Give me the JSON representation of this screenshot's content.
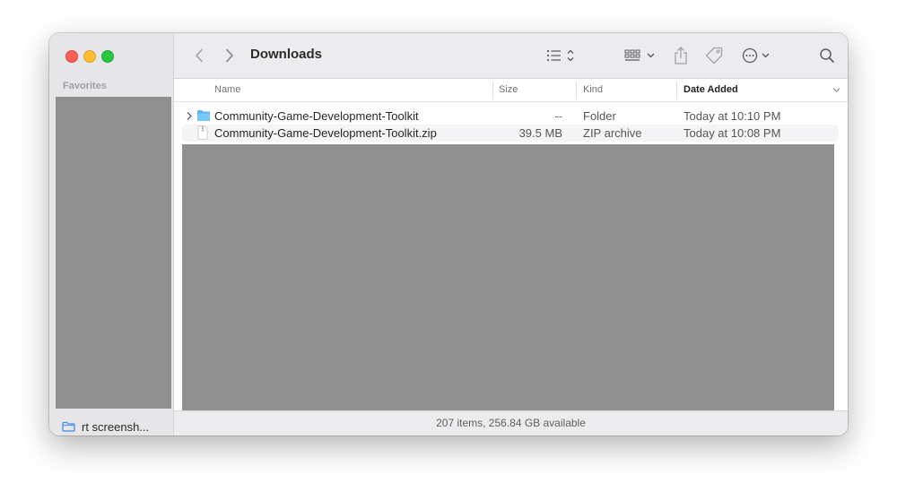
{
  "toolbar": {
    "title": "Downloads"
  },
  "sidebar": {
    "section_label": "Favorites",
    "visible_item": "rt screensh..."
  },
  "columns": {
    "name": "Name",
    "size": "Size",
    "kind": "Kind",
    "date_added": "Date Added"
  },
  "files": [
    {
      "name": "Community-Game-Development-Toolkit",
      "size": "--",
      "kind": "Folder",
      "date_added": "Today at 10:10 PM"
    },
    {
      "name": "Community-Game-Development-Toolkit.zip",
      "size": "39.5 MB",
      "kind": "ZIP archive",
      "date_added": "Today at 10:08 PM"
    }
  ],
  "status": {
    "text": "207 items, 256.84 GB available"
  }
}
